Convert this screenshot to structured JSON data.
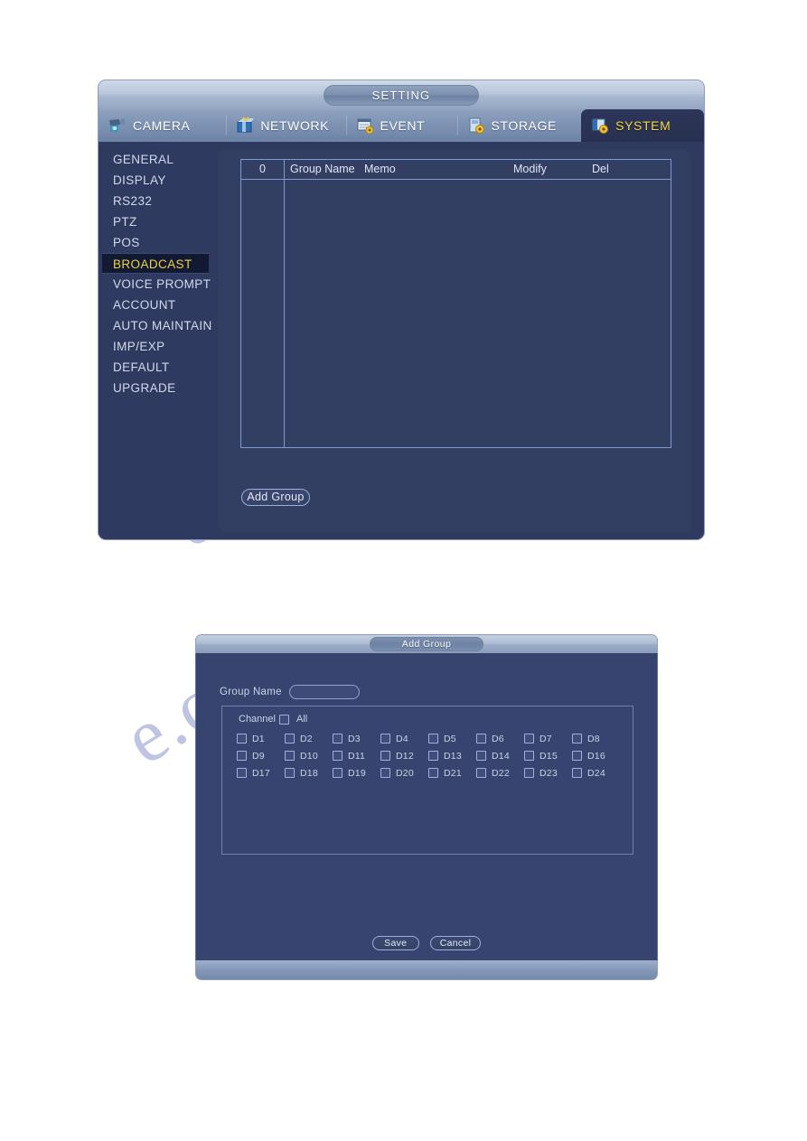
{
  "setting_window": {
    "title": "SETTING",
    "tabs": [
      {
        "label": "CAMERA",
        "icon": "camera-icon",
        "active": false
      },
      {
        "label": "NETWORK",
        "icon": "network-icon",
        "active": false
      },
      {
        "label": "EVENT",
        "icon": "event-icon",
        "active": false
      },
      {
        "label": "STORAGE",
        "icon": "storage-icon",
        "active": false
      },
      {
        "label": "SYSTEM",
        "icon": "system-icon",
        "active": true
      }
    ],
    "sidebar": {
      "items": [
        {
          "label": "GENERAL",
          "active": false
        },
        {
          "label": "DISPLAY",
          "active": false
        },
        {
          "label": "RS232",
          "active": false
        },
        {
          "label": "PTZ",
          "active": false
        },
        {
          "label": "POS",
          "active": false
        },
        {
          "label": "BROADCAST",
          "active": true
        },
        {
          "label": "VOICE PROMPT",
          "active": false
        },
        {
          "label": "ACCOUNT",
          "active": false
        },
        {
          "label": "AUTO MAINTAIN",
          "active": false
        },
        {
          "label": "IMP/EXP",
          "active": false
        },
        {
          "label": "DEFAULT",
          "active": false
        },
        {
          "label": "UPGRADE",
          "active": false
        }
      ]
    },
    "group_table": {
      "headers": {
        "index": "0",
        "group_name": "Group Name",
        "memo": "Memo",
        "modify": "Modify",
        "del": "Del"
      },
      "rows": []
    },
    "add_group_button": "Add Group"
  },
  "add_group_dialog": {
    "title": "Add Group",
    "group_name_label": "Group Name",
    "group_name_value": "",
    "group_name_placeholder": "",
    "channel_label": "Channel",
    "all_label": "All",
    "all_checked": false,
    "channels": [
      {
        "label": "D1",
        "checked": false
      },
      {
        "label": "D2",
        "checked": false
      },
      {
        "label": "D3",
        "checked": false
      },
      {
        "label": "D4",
        "checked": false
      },
      {
        "label": "D5",
        "checked": false
      },
      {
        "label": "D6",
        "checked": false
      },
      {
        "label": "D7",
        "checked": false
      },
      {
        "label": "D8",
        "checked": false
      },
      {
        "label": "D9",
        "checked": false
      },
      {
        "label": "D10",
        "checked": false
      },
      {
        "label": "D11",
        "checked": false
      },
      {
        "label": "D12",
        "checked": false
      },
      {
        "label": "D13",
        "checked": false
      },
      {
        "label": "D14",
        "checked": false
      },
      {
        "label": "D15",
        "checked": false
      },
      {
        "label": "D16",
        "checked": false
      },
      {
        "label": "D17",
        "checked": false
      },
      {
        "label": "D18",
        "checked": false
      },
      {
        "label": "D19",
        "checked": false
      },
      {
        "label": "D20",
        "checked": false
      },
      {
        "label": "D21",
        "checked": false
      },
      {
        "label": "D22",
        "checked": false
      },
      {
        "label": "D23",
        "checked": false
      },
      {
        "label": "D24",
        "checked": false
      }
    ],
    "save_label": "Save",
    "cancel_label": "Cancel"
  },
  "watermark": {
    "line1": "e.com",
    "line2": "e.com"
  },
  "colors": {
    "accent_yellow": "#f1d03c",
    "panel_bg": "#2e3a60",
    "content_bg": "#333e63",
    "dialog_bg": "#384470",
    "table_border": "#7f9ad0",
    "text_primary": "#d3d9e8"
  }
}
